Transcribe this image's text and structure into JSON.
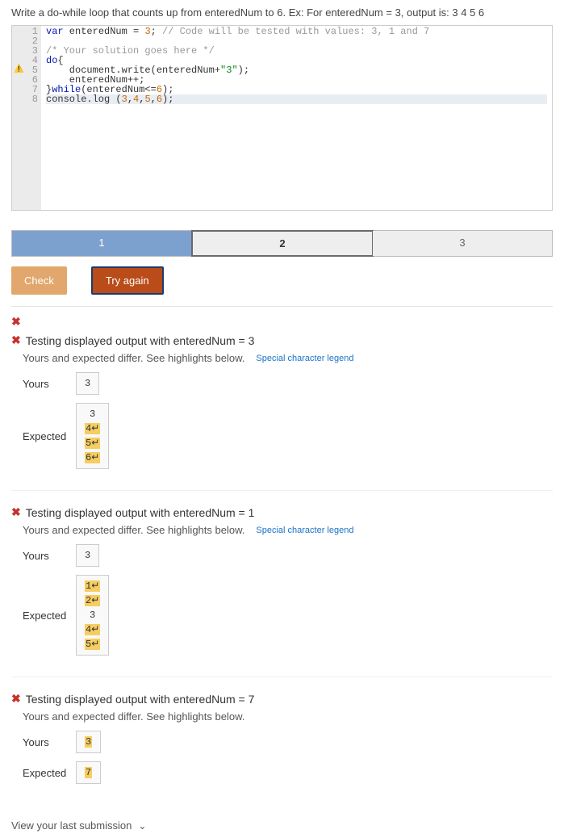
{
  "instruction": "Write a do-while loop that counts up from enteredNum to 6. Ex: For enteredNum = 3, output is: 3 4 5 6",
  "editor": {
    "gutter": [
      "1",
      "2",
      "3",
      "4",
      "5",
      "6",
      "7",
      "8"
    ],
    "warnLine": 5,
    "code": {
      "l1p1": "var",
      "l1p2": " enteredNum = ",
      "l1p3": "3",
      "l1p4": "; ",
      "l1p5": "// Code will be tested with values: 3, 1 and 7",
      "l2": "",
      "l3": "/* Your solution goes here */",
      "l4p1": "do",
      "l4p2": "{",
      "l5p1": "    document.write(enteredNum+",
      "l5p2": "\"3\"",
      "l5p3": ");",
      "l6": "    enteredNum++;",
      "l7p1": "}",
      "l7p2": "while",
      "l7p3": "(enteredNum<=",
      "l7p4": "6",
      "l7p5": ");",
      "l8p1": "console.log (",
      "l8p2": "3",
      "l8p3": ",",
      "l8p4": "4",
      "l8p5": ",",
      "l8p6": "5",
      "l8p7": ",",
      "l8p8": "6",
      "l8p9": ");"
    }
  },
  "tabs": {
    "t1": "1",
    "t2": "2",
    "t3": "3"
  },
  "buttons": {
    "check": "Check",
    "tryAgain": "Try again"
  },
  "icons": {
    "fail": "✖",
    "arrow": "↵",
    "chev": "⌄"
  },
  "legend": "Special character legend",
  "diffMsg": "Yours and expected differ. See highlights below.",
  "labels": {
    "yours": "Yours",
    "expected": "Expected"
  },
  "tests": {
    "t1": {
      "title": "Testing displayed output with enteredNum = 3",
      "yours": "3",
      "expected": [
        "3",
        "4↵",
        "5↵",
        "6↵"
      ]
    },
    "t2": {
      "title": "Testing displayed output with enteredNum = 1",
      "yours": "3",
      "expected": [
        "1↵",
        "2↵",
        "3",
        "4↵",
        "5↵"
      ]
    },
    "t3": {
      "title": "Testing displayed output with enteredNum = 7",
      "yours": "3",
      "expected": "7"
    }
  },
  "viewLast": "View your last submission"
}
